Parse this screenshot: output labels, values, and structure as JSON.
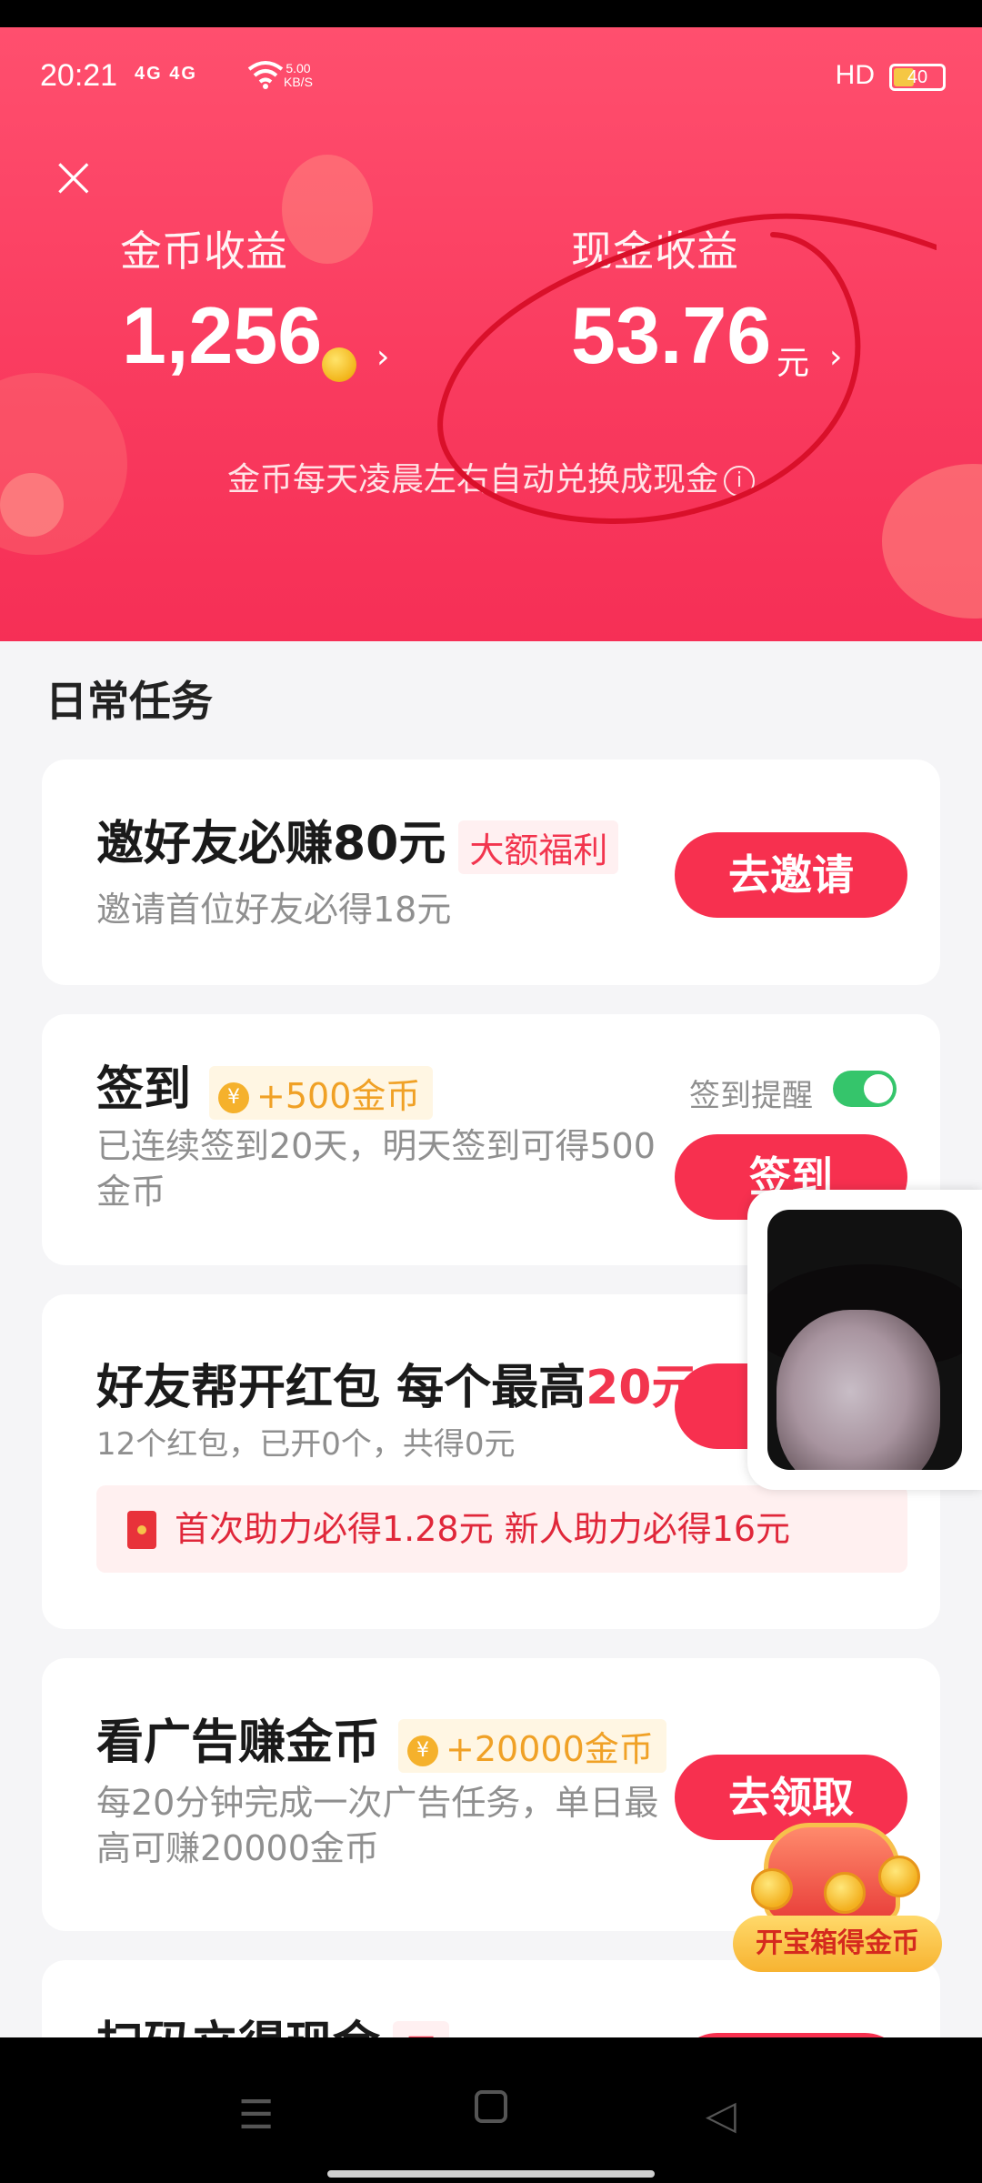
{
  "status_bar": {
    "time": "20:21",
    "signal": "4G 4G",
    "net_speed_value": "5.00",
    "net_speed_unit": "KB/S",
    "hd": "HD",
    "battery": "40"
  },
  "header": {
    "coin_label": "金币收益",
    "coin_value": "1,256",
    "cash_label": "现金收益",
    "cash_value": "53.76",
    "cash_unit": "元",
    "note": "金币每天凌晨左右自动兑换成现金",
    "chevron": "›"
  },
  "section_title": "日常任务",
  "tasks": [
    {
      "title": "邀好友必赚80元",
      "tag": "大额福利",
      "sub": "邀请首位好友必得18元",
      "button": "去邀请"
    },
    {
      "title": "签到",
      "tag": "+500金币",
      "sub": "已连续签到20天，明天签到可得500金币",
      "button": "签到",
      "toggle_label": "签到提醒",
      "toggle_on": true
    },
    {
      "title": "好友帮开红包 每个最高",
      "title_highlight": "20元",
      "sub": "12个红包，已开0个，共得0元",
      "strip": "首次助力必得1.28元 新人助力必得16元",
      "button": "去"
    },
    {
      "title": "看广告赚金币",
      "tag": "+20000金币",
      "sub": "每20分钟完成一次广告任务，单日最高可赚20000金币",
      "button": "去领取"
    },
    {
      "title": "扫码立得现金",
      "tag": "元"
    }
  ],
  "treasure_chest": {
    "label": "开宝箱得金币"
  },
  "icons": {
    "yuan_coin": "¥",
    "close": "×",
    "info": "i",
    "menu": "☰",
    "back": "◁"
  },
  "colors": {
    "header_red": "#f93a5e",
    "button_red": "#f7304f",
    "toggle_green": "#35c56b",
    "coin_gold": "#f5b12c"
  }
}
